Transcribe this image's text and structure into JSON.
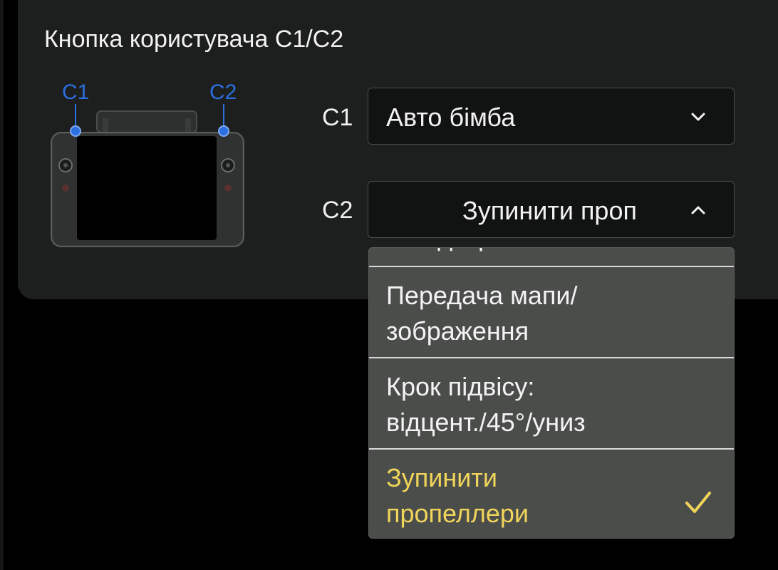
{
  "card": {
    "title": "Кнопка користувача С1/С2"
  },
  "rc_image": {
    "c1_label": "C1",
    "c2_label": "C2"
  },
  "c1": {
    "label": "С1",
    "value": "Авто бімба"
  },
  "c2": {
    "label": "С2",
    "value": "Зупинити проп"
  },
  "dropdown": {
    "partial_option": "Швидк. режим",
    "options": [
      {
        "line1": "Передача мапи/",
        "line2": "зображення"
      },
      {
        "line1": "Крок підвісу:",
        "line2": "відцент./45°/униз"
      },
      {
        "line1": "Зупинити",
        "line2": "пропеллери"
      }
    ],
    "selected_index": 2
  },
  "colors": {
    "accent_blue": "#2b6fe0",
    "selected_yellow": "#f0d55a",
    "card_bg": "#1d1e1e",
    "dropdown_bg": "#4b4d4b"
  },
  "icons": {
    "c1_chevron": "chevron-down-icon",
    "c2_chevron": "chevron-up-icon",
    "selected_mark": "check-icon"
  }
}
